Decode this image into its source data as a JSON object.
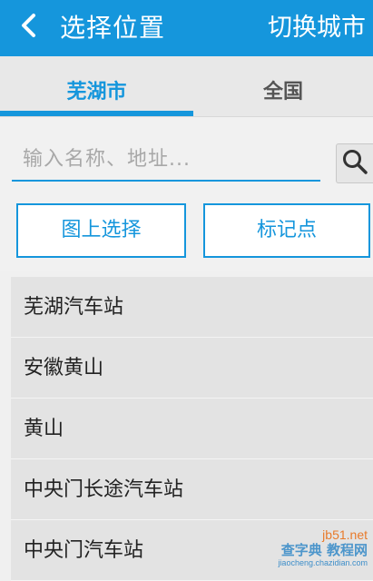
{
  "colors": {
    "accent": "#1596dc",
    "header_text": "#ffffff",
    "tab_bg": "#e8e8e8",
    "list_bg": "#e3e3e3"
  },
  "header": {
    "back_icon": "chevron-left-icon",
    "title": "选择位置",
    "switch_city": "切换城市"
  },
  "tabs": [
    {
      "label": "芜湖市",
      "active": true
    },
    {
      "label": "全国",
      "active": false
    }
  ],
  "search": {
    "placeholder": "输入名称、地址...",
    "value": "",
    "icon": "search-icon"
  },
  "actions": {
    "map_select": "图上选择",
    "mark_point": "标记点"
  },
  "results": [
    {
      "name": "芜湖汽车站"
    },
    {
      "name": "安徽黄山"
    },
    {
      "name": "黄山"
    },
    {
      "name": "中央门长途汽车站"
    },
    {
      "name": "中央门汽车站"
    }
  ],
  "watermark": {
    "site": "jb51.net",
    "text": "查字典 教程网",
    "sub": "jiaocheng.chazidian.com"
  }
}
